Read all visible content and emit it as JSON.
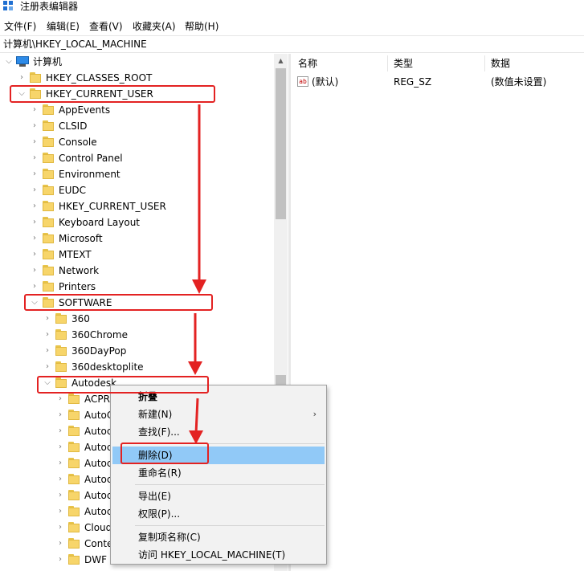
{
  "window": {
    "title": "注册表编辑器"
  },
  "menu": [
    "文件(F)",
    "编辑(E)",
    "查看(V)",
    "收藏夹(A)",
    "帮助(H)"
  ],
  "address": "计算机\\HKEY_LOCAL_MACHINE",
  "tree": {
    "root": "计算机",
    "items": [
      {
        "label": "HKEY_CLASSES_ROOT",
        "level": 1,
        "expanded": false
      },
      {
        "label": "HKEY_CURRENT_USER",
        "level": 1,
        "expanded": true
      },
      {
        "label": "AppEvents",
        "level": 2,
        "expanded": false
      },
      {
        "label": "CLSID",
        "level": 2,
        "expanded": false
      },
      {
        "label": "Console",
        "level": 2,
        "expanded": false
      },
      {
        "label": "Control Panel",
        "level": 2,
        "expanded": false
      },
      {
        "label": "Environment",
        "level": 2,
        "expanded": false
      },
      {
        "label": "EUDC",
        "level": 2,
        "expanded": false
      },
      {
        "label": "HKEY_CURRENT_USER",
        "level": 2,
        "expanded": false
      },
      {
        "label": "Keyboard Layout",
        "level": 2,
        "expanded": false
      },
      {
        "label": "Microsoft",
        "level": 2,
        "expanded": false
      },
      {
        "label": "MTEXT",
        "level": 2,
        "expanded": false
      },
      {
        "label": "Network",
        "level": 2,
        "expanded": false
      },
      {
        "label": "Printers",
        "level": 2,
        "expanded": false
      },
      {
        "label": "SOFTWARE",
        "level": 2,
        "expanded": true
      },
      {
        "label": "360",
        "level": 3,
        "expanded": false
      },
      {
        "label": "360Chrome",
        "level": 3,
        "expanded": false
      },
      {
        "label": "360DayPop",
        "level": 3,
        "expanded": false
      },
      {
        "label": "360desktoplite",
        "level": 3,
        "expanded": false
      },
      {
        "label": "Autodesk",
        "level": 3,
        "expanded": true
      },
      {
        "label": "ACPR",
        "level": 4,
        "expanded": false
      },
      {
        "label": "AutoC",
        "level": 4,
        "expanded": false
      },
      {
        "label": "Autoc",
        "level": 4,
        "expanded": false
      },
      {
        "label": "Autoc",
        "level": 4,
        "expanded": false
      },
      {
        "label": "Autoc",
        "level": 4,
        "expanded": false
      },
      {
        "label": "Autoc",
        "level": 4,
        "expanded": false
      },
      {
        "label": "Autoc",
        "level": 4,
        "expanded": false
      },
      {
        "label": "Autoc",
        "level": 4,
        "expanded": false
      },
      {
        "label": "Cloud",
        "level": 4,
        "expanded": false
      },
      {
        "label": "Conte",
        "level": 4,
        "expanded": false
      },
      {
        "label": "DWF",
        "level": 4,
        "expanded": false
      }
    ]
  },
  "list": {
    "columns": [
      "名称",
      "类型",
      "数据"
    ],
    "rows": [
      {
        "name": "(默认)",
        "type": "REG_SZ",
        "data": "(数值未设置)",
        "icon": "ab"
      }
    ]
  },
  "context_menu": {
    "items": [
      {
        "label": "折叠",
        "bold": true
      },
      {
        "label": "新建(N)",
        "submenu": true
      },
      {
        "label": "查找(F)..."
      },
      {
        "label": "删除(D)",
        "highlighted": true
      },
      {
        "label": "重命名(R)"
      },
      {
        "label": "导出(E)"
      },
      {
        "label": "权限(P)..."
      },
      {
        "label": "复制项名称(C)"
      },
      {
        "label": "访问 HKEY_LOCAL_MACHINE(T)"
      }
    ]
  },
  "colors": {
    "annotation": "#e32222",
    "highlight": "#91c9f7",
    "folder": "#f7d56a"
  }
}
